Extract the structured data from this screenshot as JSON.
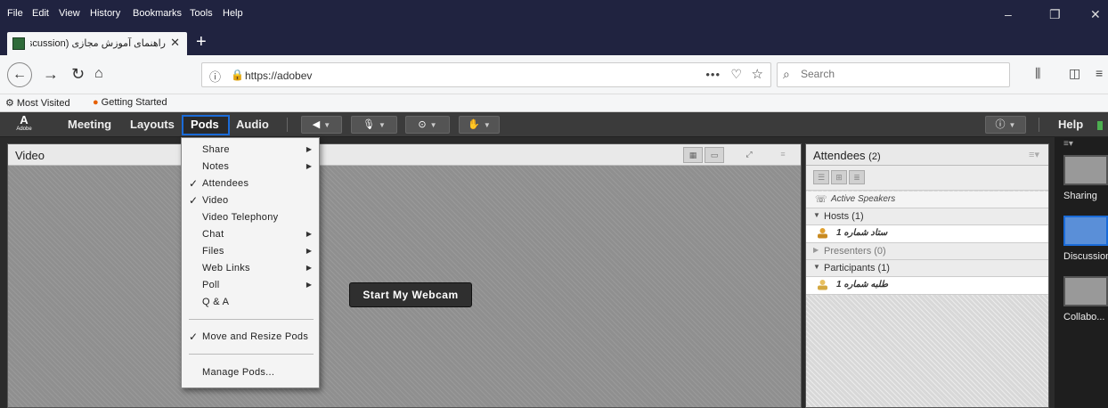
{
  "browser": {
    "menu": [
      "File",
      "Edit",
      "View",
      "History",
      "Bookmarks",
      "Tools",
      "Help"
    ],
    "window_controls": {
      "minimize": "–",
      "restore": "❐",
      "close": "✕"
    },
    "tab": {
      "title": "راهنمای آموزش مجازی (Discussion)",
      "close": "✕"
    },
    "new_tab": "+",
    "url": "https://adobev",
    "search_placeholder": "Search",
    "bookmarks": [
      "Most Visited",
      "Getting Started"
    ]
  },
  "connect": {
    "logo": "A",
    "logo_sub": "Adobe",
    "menus": [
      "Meeting",
      "Layouts",
      "Pods",
      "Audio"
    ],
    "active_menu": "Pods",
    "help": "Help"
  },
  "video_pod": {
    "title": "Video",
    "webcam_button": "Start My Webcam"
  },
  "attendees_pod": {
    "title": "Attendees",
    "count": "(2)",
    "active_speakers": "Active Speakers",
    "groups": [
      {
        "label": "Hosts (1)",
        "expanded": true,
        "users": [
          "ستاد شماره 1"
        ]
      },
      {
        "label": "Presenters (0)",
        "expanded": false,
        "users": []
      },
      {
        "label": "Participants (1)",
        "expanded": true,
        "users": [
          "طلبه شماره 1"
        ]
      }
    ]
  },
  "layouts": [
    {
      "label": "Sharing",
      "active": false
    },
    {
      "label": "Discussion",
      "active": true
    },
    {
      "label": "Collabo...",
      "active": false
    }
  ],
  "pods_menu": {
    "items": [
      {
        "label": "Share",
        "checked": false,
        "submenu": true
      },
      {
        "label": "Notes",
        "checked": false,
        "submenu": true
      },
      {
        "label": "Attendees",
        "checked": true,
        "submenu": false
      },
      {
        "label": "Video",
        "checked": true,
        "submenu": false
      },
      {
        "label": "Video Telephony",
        "checked": false,
        "submenu": false
      },
      {
        "label": "Chat",
        "checked": false,
        "submenu": true
      },
      {
        "label": "Files",
        "checked": false,
        "submenu": true
      },
      {
        "label": "Web Links",
        "checked": false,
        "submenu": true
      },
      {
        "label": "Poll",
        "checked": false,
        "submenu": true
      },
      {
        "label": "Q & A",
        "checked": false,
        "submenu": false
      },
      {
        "label": "Move and Resize Pods",
        "checked": true,
        "submenu": false
      },
      {
        "label": "Manage Pods...",
        "checked": false,
        "submenu": false
      }
    ]
  },
  "colors": {
    "accent": "#1a6bd8",
    "titlebar": "#202340",
    "connect_bar": "#3b3b3b"
  }
}
